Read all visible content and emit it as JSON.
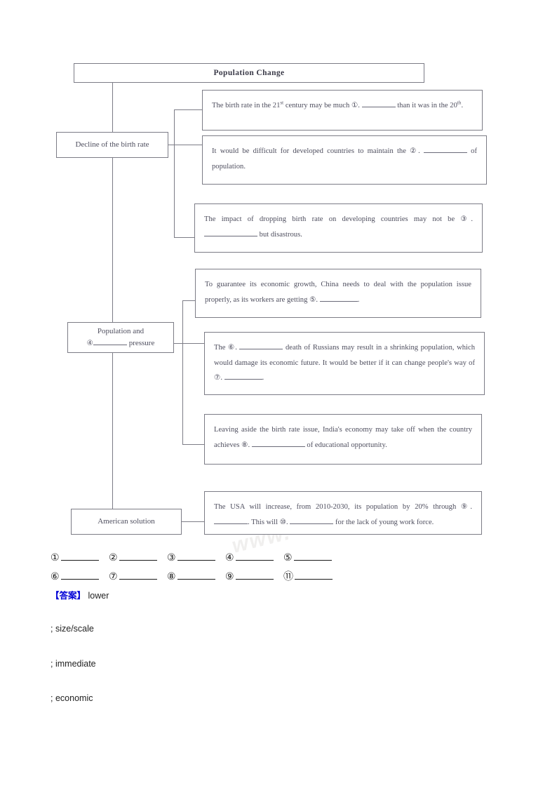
{
  "document": {
    "watermark": "www.",
    "title_box": {
      "label": "Population Change"
    },
    "nodes": [
      {
        "id": "decline",
        "label": "Decline of the birth rate"
      },
      {
        "id": "pressure",
        "label_line1": "Population and",
        "label_line2_prefix": "④",
        "label_line2_suffix": "pressure"
      },
      {
        "id": "american",
        "label": "American solution"
      }
    ],
    "content_boxes": [
      {
        "id": "birth-rate-21st",
        "segments": [
          {
            "t": "The birth rate in the 21"
          },
          {
            "sup": "st"
          },
          {
            "t": " century may be much  "
          },
          {
            "num": "①"
          },
          {
            "t": ". "
          },
          {
            "blank": 48
          },
          {
            "t": " than it was in the 20"
          },
          {
            "sup": "th"
          },
          {
            "t": "."
          }
        ]
      },
      {
        "id": "developed-countries",
        "segments": [
          {
            "t": "It would be difficult for developed countries to maintain the  "
          },
          {
            "num": "②"
          },
          {
            "t": ". "
          },
          {
            "blank": 62
          },
          {
            "t": " of population."
          }
        ]
      },
      {
        "id": "developing-countries",
        "segments": [
          {
            "t": "The impact of dropping birth rate on developing countries may not be  "
          },
          {
            "num": "③"
          },
          {
            "t": ". "
          },
          {
            "blank": 76
          },
          {
            "t": " but disastrous."
          }
        ]
      },
      {
        "id": "china",
        "segments": [
          {
            "t": "To guarantee its economic growth, China needs to deal with the population issue properly, as its workers are getting  "
          },
          {
            "num": "⑤"
          },
          {
            "t": ". "
          },
          {
            "blank": 54
          },
          {
            "t": "."
          }
        ]
      },
      {
        "id": "russia",
        "segments": [
          {
            "t": "The  "
          },
          {
            "num": "⑥"
          },
          {
            "t": ". "
          },
          {
            "blank": 62
          },
          {
            "t": " death of Russians may result in a shrinking population, which would damage its economic future. It would be better if it can change people's way of  "
          },
          {
            "num": "⑦"
          },
          {
            "t": ". "
          },
          {
            "blank": 54
          },
          {
            "t": "."
          }
        ]
      },
      {
        "id": "india",
        "segments": [
          {
            "t": "Leaving aside the birth rate issue, India's economy may take off when the country achieves  "
          },
          {
            "num": "⑧"
          },
          {
            "t": ". "
          },
          {
            "blank": 76
          },
          {
            "t": " of educational opportunity."
          }
        ]
      },
      {
        "id": "usa",
        "segments": [
          {
            "t": "The USA will increase, from 2010-2030, its population by 20% through  "
          },
          {
            "num": "⑨"
          },
          {
            "t": ". "
          },
          {
            "blank": 48
          },
          {
            "t": ". This will  "
          },
          {
            "num": "⑩"
          },
          {
            "t": ". "
          },
          {
            "blank": 62
          },
          {
            "t": " for the lack of young work force."
          }
        ]
      }
    ],
    "answer_blanks": {
      "row1": [
        "①",
        "②",
        "③",
        "④",
        "⑤"
      ],
      "row2": [
        "⑥",
        "⑦",
        "⑧",
        "⑨",
        "⑪"
      ]
    },
    "answer_key": [
      {
        "tag": "【答案】",
        "sep": "",
        "text": "lower"
      },
      {
        "tag": "",
        "sep": ";",
        "text": "size/scale"
      },
      {
        "tag": "",
        "sep": ";",
        "text": "immediate"
      },
      {
        "tag": "",
        "sep": ";",
        "text": "economic"
      }
    ]
  }
}
